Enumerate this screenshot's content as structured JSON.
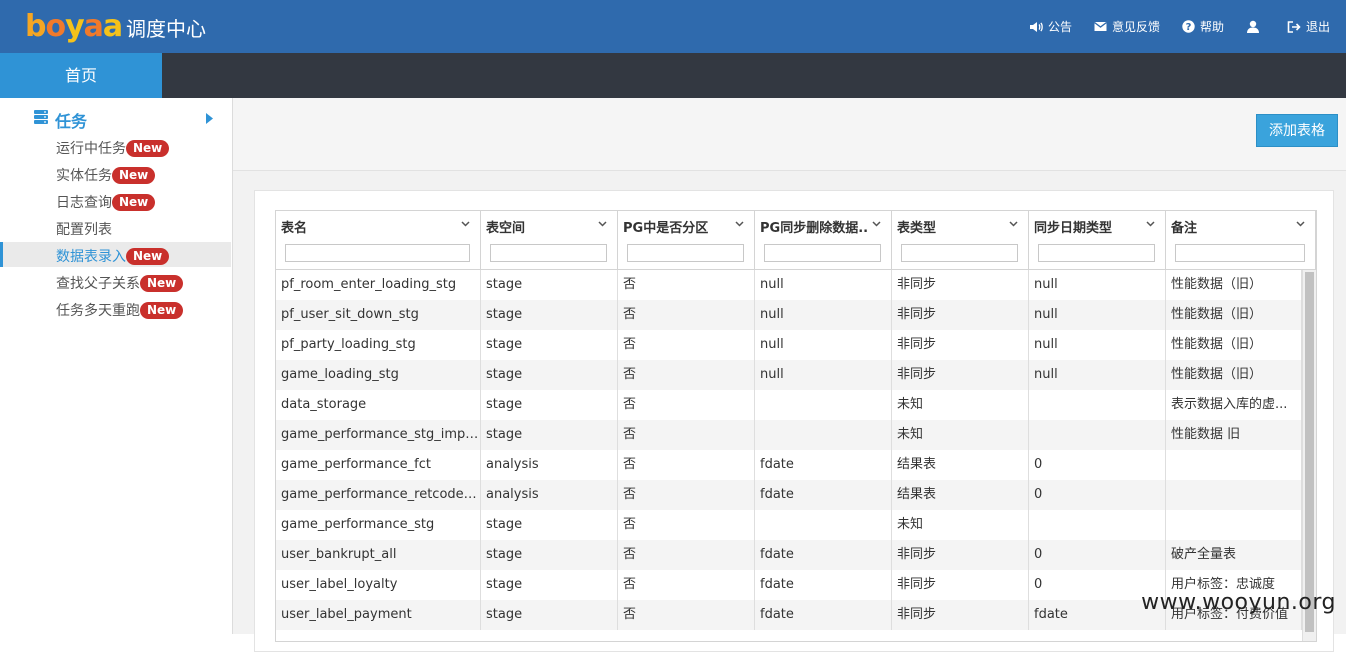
{
  "header": {
    "logo_text": "boyaa",
    "app_title": "调度中心",
    "nav": [
      {
        "label": "公告",
        "icon": "speaker-icon"
      },
      {
        "label": "意见反馈",
        "icon": "envelope-icon"
      },
      {
        "label": "帮助",
        "icon": "question-circle-icon"
      },
      {
        "label": "",
        "icon": "user-icon"
      },
      {
        "label": "退出",
        "icon": "logout-icon"
      }
    ]
  },
  "tabs": {
    "home": "首页"
  },
  "sidebar": {
    "group_label": "任务",
    "badge_text": "New",
    "items": [
      {
        "label": "运行中任务",
        "badge": true,
        "active": false
      },
      {
        "label": "实体任务",
        "badge": true,
        "active": false
      },
      {
        "label": "日志查询",
        "badge": true,
        "active": false
      },
      {
        "label": "配置列表",
        "badge": false,
        "active": false
      },
      {
        "label": "数据表录入",
        "badge": true,
        "active": true
      },
      {
        "label": "查找父子关系",
        "badge": true,
        "active": false
      },
      {
        "label": "任务多天重跑",
        "badge": true,
        "active": false
      }
    ]
  },
  "toolbar": {
    "add_label": "添加表格"
  },
  "table": {
    "columns": [
      "表名",
      "表空间",
      "PG中是否分区",
      "PG同步删除数据...",
      "表类型",
      "同步日期类型",
      "备注"
    ],
    "rows": [
      [
        "pf_room_enter_loading_stg",
        "stage",
        "否",
        "null",
        "非同步",
        "null",
        "性能数据（旧）"
      ],
      [
        "pf_user_sit_down_stg",
        "stage",
        "否",
        "null",
        "非同步",
        "null",
        "性能数据（旧）"
      ],
      [
        "pf_party_loading_stg",
        "stage",
        "否",
        "null",
        "非同步",
        "null",
        "性能数据（旧）"
      ],
      [
        "game_loading_stg",
        "stage",
        "否",
        "null",
        "非同步",
        "null",
        "性能数据（旧）"
      ],
      [
        "data_storage",
        "stage",
        "否",
        "",
        "未知",
        "",
        "表示数据入库的虚..."
      ],
      [
        "game_performance_stg_impo...",
        "stage",
        "否",
        "",
        "未知",
        "",
        "性能数据 旧"
      ],
      [
        "game_performance_fct",
        "analysis",
        "否",
        "fdate",
        "结果表",
        "0",
        ""
      ],
      [
        "game_performance_retcode_f...",
        "analysis",
        "否",
        "fdate",
        "结果表",
        "0",
        ""
      ],
      [
        "game_performance_stg",
        "stage",
        "否",
        "",
        "未知",
        "",
        ""
      ],
      [
        "user_bankrupt_all",
        "stage",
        "否",
        "fdate",
        "非同步",
        "0",
        "破产全量表"
      ],
      [
        "user_label_loyalty",
        "stage",
        "否",
        "fdate",
        "非同步",
        "0",
        "用户标签：忠诚度"
      ],
      [
        "user_label_payment",
        "stage",
        "否",
        "fdate",
        "非同步",
        "fdate",
        "用户标签：付费价值"
      ]
    ]
  },
  "watermark": "www.wooyun.org"
}
